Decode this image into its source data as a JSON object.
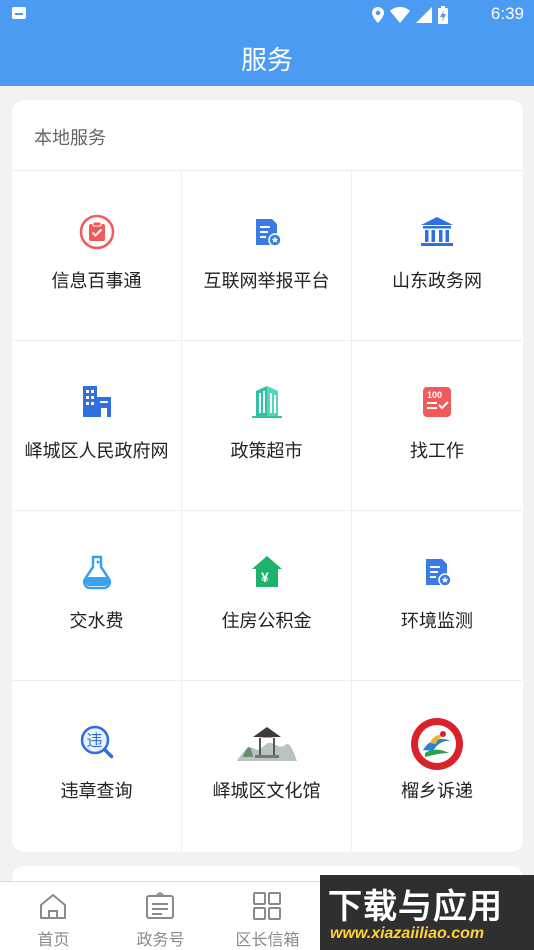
{
  "status_bar": {
    "time": "6:39",
    "battery": "battery-charging"
  },
  "header": {
    "title": "服务"
  },
  "section": {
    "title": "本地服务"
  },
  "services": [
    {
      "label": "信息百事通",
      "icon": "clipboard-check-icon",
      "color": "#f05a5a"
    },
    {
      "label": "互联网举报平台",
      "icon": "document-star-icon",
      "color": "#3a7be8"
    },
    {
      "label": "山东政务网",
      "icon": "government-building-icon",
      "color": "#2f6fe0"
    },
    {
      "label": "峄城区人民政府网",
      "icon": "office-buildings-icon",
      "color": "#2f6fe0"
    },
    {
      "label": "政策超市",
      "icon": "building-teal-icon",
      "color": "#33c7a8"
    },
    {
      "label": "找工作",
      "icon": "score-100-icon",
      "color": "#f05a5a"
    },
    {
      "label": "交水费",
      "icon": "flask-icon",
      "color": "#3aa0f0"
    },
    {
      "label": "住房公积金",
      "icon": "house-yen-icon",
      "color": "#1db36b"
    },
    {
      "label": "环境监测",
      "icon": "document-star-icon",
      "color": "#3a7be8"
    },
    {
      "label": "违章查询",
      "icon": "magnifier-violation-icon",
      "color": "#2f6fe0"
    },
    {
      "label": "峄城区文化馆",
      "icon": "pavilion-icon",
      "color": "#6a6a6a"
    },
    {
      "label": "榴乡诉递",
      "icon": "round-emblem-icon",
      "color": "#d9232a"
    }
  ],
  "tabs": [
    {
      "label": "首页",
      "icon": "home-icon"
    },
    {
      "label": "政务号",
      "icon": "list-box-icon"
    },
    {
      "label": "区长信箱",
      "icon": "grid-icon"
    }
  ],
  "watermark": {
    "line1": "下载与应用",
    "line2": "www.xiazaiiliao.com"
  }
}
